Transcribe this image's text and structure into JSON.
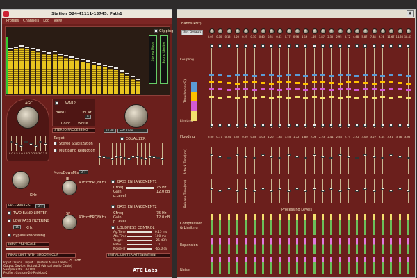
{
  "left_window": {
    "title": "Station Q24-41111-13745: Path1",
    "menu": [
      "Profiles",
      "Channels",
      "Log",
      "View"
    ],
    "clipping_label": "Clipping",
    "meter_labels": [
      "Stereo Mode",
      "Sound Limiter"
    ],
    "agc": {
      "label": "AGC",
      "title": "AUTO GAIN CONTROL"
    },
    "warp_label": "WARP",
    "band_label": "BAND",
    "delay_label": "DELAY",
    "delay_value": "0",
    "color_label": "Color",
    "white_label": "White",
    "stereo_processing": "STEREO PROCESSING",
    "agc_value": "24 dB",
    "agc_mode": "Soft Knee",
    "target_label": "Target",
    "stereo_stabilization": "Stereo Stabilization",
    "multiband_reduction": "MultiBand Reduction",
    "mono_downmix": "MonoDownMix",
    "mono_value": "OFF",
    "equalizer": "EQUALIZER",
    "eq_scale": [
      "0.0",
      "0.5",
      "1.0",
      "1.5",
      "2.0",
      "2.5",
      "3.0",
      "3.5"
    ],
    "ie_label": "IE",
    "ie_bands": [
      "40Hz",
      "HFRQ",
      "8KHz"
    ],
    "sp_label": "SP",
    "sp_bands": [
      "40Hz",
      "HFRQ",
      "8KHz"
    ],
    "khz_label": "KHz",
    "preemphasis": "PREEMPHASIS",
    "preemphasis_value": "OFF",
    "two_band_limiter": "TWO BAND LIMITER",
    "low_pass_filtering": "LOW PASS FILTERING",
    "low_pass_value": "15",
    "bypass_processing": "Bypass Processing",
    "input_pre_scale": "INPUT PRE-SCALE",
    "final_limit": "FINAL LIMIT WITH SMOOTH CLIP",
    "final_limit_value": "-5.0 dB",
    "bass1": {
      "title": "BASS ENHANCEMENT1",
      "rows": [
        [
          "CFreq",
          "75 Hz"
        ],
        [
          "Gain",
          "12.0 dB"
        ],
        [
          "p.Level",
          ""
        ]
      ]
    },
    "bass2": {
      "title": "BASS ENHANCEMENT2",
      "rows": [
        [
          "CFreq",
          "75 Hz"
        ],
        [
          "Gain",
          "12.0 dB"
        ],
        [
          "p.Level",
          ""
        ]
      ]
    },
    "loudness": {
      "title": "LOUDNESS CONTROL",
      "rows": [
        [
          "Ag.Time",
          "0.15 ms"
        ],
        [
          "Atk.Time",
          "100 ms"
        ],
        [
          "Target",
          "-25 dBfs"
        ],
        [
          "Ratio",
          "1.0"
        ],
        [
          "NoiseFlr",
          "-65.0 dB"
        ]
      ]
    },
    "initial_limiter": "INITIAL LIMITER ATTENUATION",
    "status": [
      "Input Device : Input 1 (Virtual Audio Cable)",
      "Output Device: Output 2 (Virtual Audio Cable)",
      "Sample Rate : 44100",
      "Profile : Custom-24-PeakUse2"
    ],
    "brand": "ATC Labs"
  },
  "right_window": {
    "close": "X",
    "header": "Bands(kHz)",
    "set_default": "Set Default",
    "band_freqs": [
      "0.05",
      "0.10",
      "0.15",
      "0.20",
      "0.25",
      "0.30",
      "0.40",
      "0.51",
      "0.63",
      "0.77",
      "0.96",
      "1.19",
      "1.49",
      "1.87",
      "2.35",
      "2.95",
      "3.72",
      "4.68",
      "5.87",
      "7.38",
      "9.28",
      "11.67",
      "14.66",
      "18.43"
    ],
    "coupling": "Coupling",
    "limiting": "Limiting",
    "thresholds": "Thresholds(dB)",
    "row_labels": [
      "Flooding",
      "Attack Time(ms)",
      "Release Time(ms)"
    ],
    "flooding_values": [
      "0.00",
      "0.17",
      "0.34",
      "0.52",
      "0.69",
      "0.86",
      "1.03",
      "1.20",
      "1.38",
      "1.55",
      "1.72",
      "1.89",
      "2.06",
      "2.23",
      "2.41",
      "2.58",
      "2.75",
      "2.92",
      "3.09",
      "3.27",
      "3.44",
      "3.61",
      "3.78",
      "3.95"
    ],
    "processing_levels": "Processing Levels",
    "level_labels": [
      "Compression & Limiting",
      "Expansion",
      "Noise"
    ]
  }
}
